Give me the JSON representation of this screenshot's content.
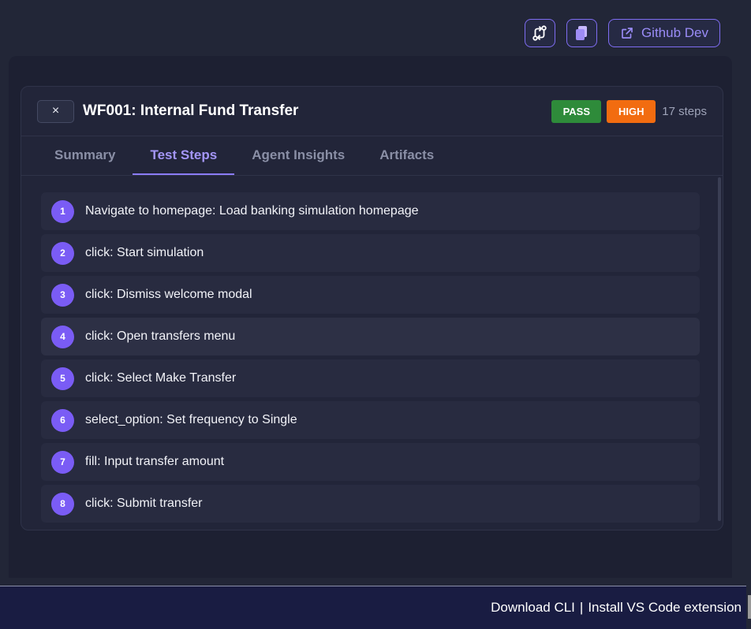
{
  "toolbar": {
    "pr_icon": "pull-request-icon",
    "copy_icon": "copy-icon",
    "github_icon": "external-link-icon",
    "github_label": "Github Dev"
  },
  "card": {
    "close_label": "×",
    "title": "WF001: Internal Fund Transfer",
    "status_badge": "PASS",
    "priority_badge": "HIGH",
    "steps_count": "17 steps"
  },
  "tabs": [
    {
      "label": "Summary",
      "active": false
    },
    {
      "label": "Test Steps",
      "active": true
    },
    {
      "label": "Agent Insights",
      "active": false
    },
    {
      "label": "Artifacts",
      "active": false
    }
  ],
  "steps": [
    {
      "num": "1",
      "text": "Navigate to homepage: Load banking simulation homepage"
    },
    {
      "num": "2",
      "text": "click: Start simulation"
    },
    {
      "num": "3",
      "text": "click: Dismiss welcome modal"
    },
    {
      "num": "4",
      "text": "click: Open transfers menu"
    },
    {
      "num": "5",
      "text": "click: Select Make Transfer"
    },
    {
      "num": "6",
      "text": "select_option: Set frequency to Single"
    },
    {
      "num": "7",
      "text": "fill: Input transfer amount"
    },
    {
      "num": "8",
      "text": "click: Submit transfer"
    }
  ],
  "footer": {
    "download_cli": "Download CLI",
    "separator": "|",
    "install_vscode": "Install VS Code extension"
  },
  "colors": {
    "accent": "#7a5cf5",
    "pass": "#2e8b3a",
    "high": "#f26c10"
  }
}
